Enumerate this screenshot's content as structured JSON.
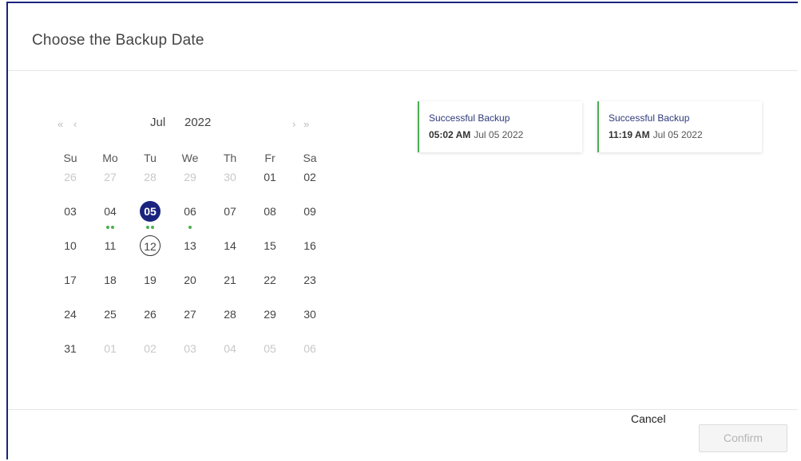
{
  "dialog": {
    "title": "Choose the Backup Date"
  },
  "calendar": {
    "nav": {
      "prev_year": "«",
      "prev_month": "‹",
      "next_month": "›",
      "next_year": "»"
    },
    "month": "Jul",
    "year": "2022",
    "weekdays": [
      "Su",
      "Mo",
      "Tu",
      "We",
      "Th",
      "Fr",
      "Sa"
    ],
    "weeks": [
      [
        {
          "d": "26",
          "m": true
        },
        {
          "d": "27",
          "m": true
        },
        {
          "d": "28",
          "m": true
        },
        {
          "d": "29",
          "m": true
        },
        {
          "d": "30",
          "m": true
        },
        {
          "d": "01"
        },
        {
          "d": "02"
        }
      ],
      [
        {
          "d": "03"
        },
        {
          "d": "04",
          "dots": 2
        },
        {
          "d": "05",
          "selected": true,
          "dots": 2
        },
        {
          "d": "06",
          "dots": 1
        },
        {
          "d": "07"
        },
        {
          "d": "08"
        },
        {
          "d": "09"
        }
      ],
      [
        {
          "d": "10"
        },
        {
          "d": "11"
        },
        {
          "d": "12",
          "today": true
        },
        {
          "d": "13"
        },
        {
          "d": "14"
        },
        {
          "d": "15"
        },
        {
          "d": "16"
        }
      ],
      [
        {
          "d": "17"
        },
        {
          "d": "18"
        },
        {
          "d": "19"
        },
        {
          "d": "20"
        },
        {
          "d": "21"
        },
        {
          "d": "22"
        },
        {
          "d": "23"
        }
      ],
      [
        {
          "d": "24"
        },
        {
          "d": "25"
        },
        {
          "d": "26"
        },
        {
          "d": "27"
        },
        {
          "d": "28"
        },
        {
          "d": "29"
        },
        {
          "d": "30"
        }
      ],
      [
        {
          "d": "31"
        },
        {
          "d": "01",
          "m": true
        },
        {
          "d": "02",
          "m": true
        },
        {
          "d": "03",
          "m": true
        },
        {
          "d": "04",
          "m": true
        },
        {
          "d": "05",
          "m": true
        },
        {
          "d": "06",
          "m": true
        }
      ]
    ],
    "colors": {
      "selected": "#1a237e",
      "backup_dot": "#4caf50"
    }
  },
  "backups": [
    {
      "status": "Successful Backup",
      "time": "05:02 AM",
      "date": "Jul 05 2022"
    },
    {
      "status": "Successful Backup",
      "time": "11:19 AM",
      "date": "Jul 05 2022"
    }
  ],
  "footer": {
    "cancel_label": "Cancel",
    "confirm_label": "Confirm"
  }
}
